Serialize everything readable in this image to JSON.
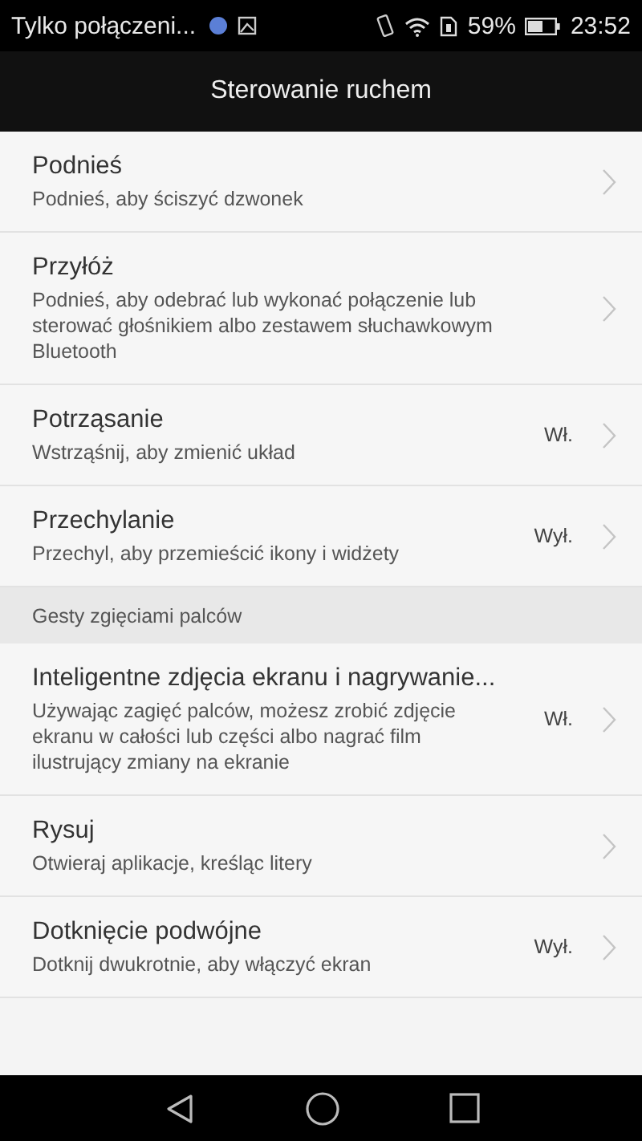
{
  "status_bar": {
    "notification": "Tylko połączeni...",
    "battery": "59%",
    "time": "23:52"
  },
  "title": "Sterowanie ruchem",
  "items": [
    {
      "kind": "row",
      "title": "Podnieś",
      "subtitle": "Podnieś, aby ściszyć dzwonek"
    },
    {
      "kind": "row",
      "title": "Przyłóż",
      "subtitle": "Podnieś, aby odebrać lub wykonać połączenie lub sterować głośnikiem albo zestawem słuchawkowym Bluetooth"
    },
    {
      "kind": "row",
      "title": "Potrząsanie",
      "subtitle": "Wstrząśnij, aby zmienić układ",
      "value": "Wł."
    },
    {
      "kind": "row",
      "title": "Przechylanie",
      "subtitle": "Przechyl, aby przemieścić ikony i widżety",
      "value": "Wył."
    },
    {
      "kind": "header",
      "title": "Gesty zgięciami palców"
    },
    {
      "kind": "row",
      "title": "Inteligentne zdjęcia ekranu i nagrywanie...",
      "subtitle": "Używając zagięć palców, możesz zrobić zdjęcie ekranu w całości lub części albo nagrać film ilustrujący zmiany na ekranie",
      "value": "Wł."
    },
    {
      "kind": "row",
      "title": "Rysuj",
      "subtitle": "Otwieraj aplikacje, kreśląc litery"
    },
    {
      "kind": "row",
      "title": "Dotknięcie podwójne",
      "subtitle": "Dotknij dwukrotnie, aby włączyć ekran",
      "value": "Wył."
    }
  ]
}
